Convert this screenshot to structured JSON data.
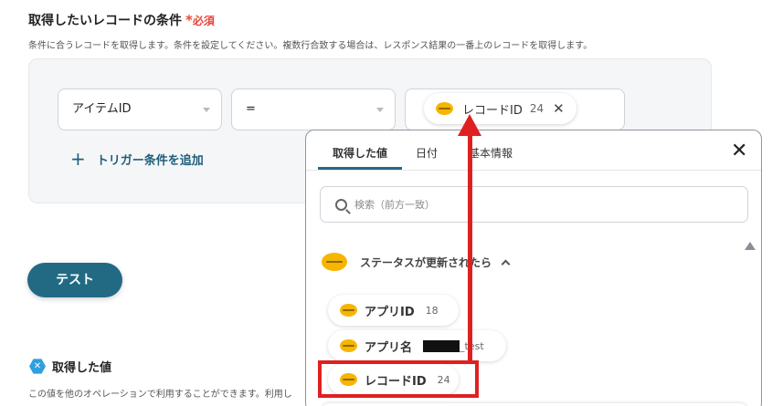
{
  "condition_section": {
    "title": "取得したいレコードの条件",
    "required_mark": "*",
    "required_label": "必須",
    "description": "条件に合うレコードを取得します。条件を設定してください。複数行合致する場合は、レスポンス結果の一番上のレコードを取得します。",
    "field_select": "アイテムID",
    "operator_select": "=",
    "value_chip": {
      "label": "レコードID",
      "count": "24"
    },
    "add_trigger_label": "トリガー条件を追加"
  },
  "test_button": "テスト",
  "obtained_section": {
    "title": "取得した値",
    "description": "この値を他のオペレーションで利用することができます。利用し"
  },
  "popup": {
    "tabs": [
      "取得した値",
      "日付",
      "基本情報"
    ],
    "search_placeholder": "検索（前方一致）",
    "group_label": "ステータスが更新されたら",
    "items": [
      {
        "label": "アプリID",
        "value": "18"
      },
      {
        "label": "アプリ名",
        "value": "_test"
      },
      {
        "label": "レコードID",
        "value": "24"
      }
    ]
  },
  "colors": {
    "accent": "#226a84",
    "required": "#e8473b",
    "highlight": "#e02020",
    "kintone_icon": "#f6b500"
  },
  "icons": {
    "kintone": "kintone-icon",
    "search": "search-icon",
    "close": "close-icon",
    "plus": "plus-icon",
    "hex": "hex-icon"
  }
}
